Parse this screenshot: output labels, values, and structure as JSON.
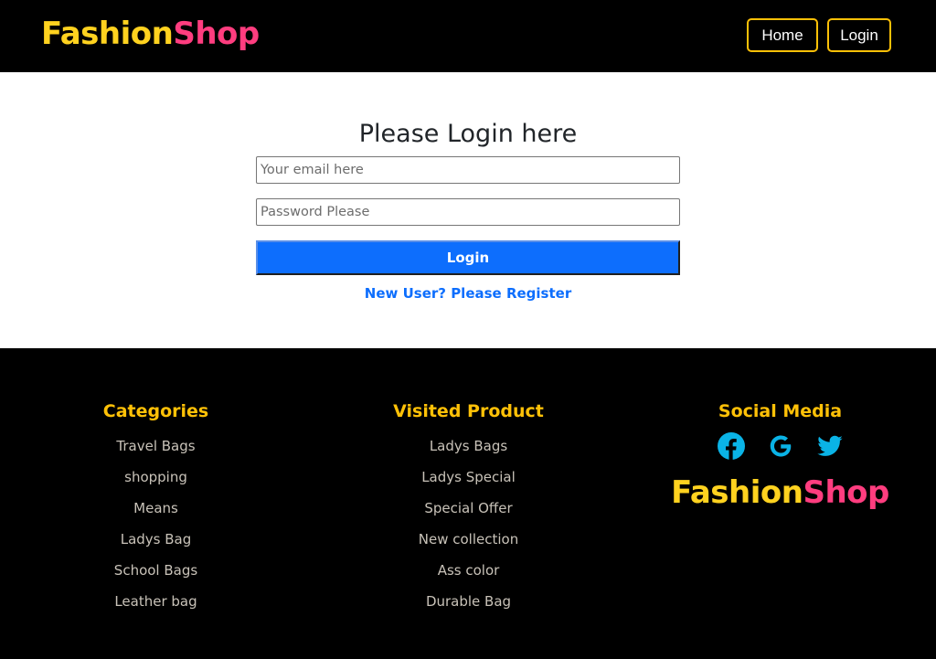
{
  "header": {
    "brand_part1": "Fashion",
    "brand_part2": "Shop",
    "nav": {
      "home_label": "Home",
      "login_label": "Login"
    }
  },
  "login_form": {
    "title": "Please Login here",
    "email_placeholder": "Your email here",
    "email_value": "",
    "password_placeholder": "Password Please",
    "password_value": "",
    "submit_label": "Login",
    "register_link": "New User? Please Register"
  },
  "footer": {
    "categories": {
      "heading": "Categories",
      "items": [
        "Travel Bags",
        "shopping",
        "Means",
        "Ladys Bag",
        "School Bags",
        "Leather bag"
      ]
    },
    "visited_product": {
      "heading": "Visited Product",
      "items": [
        "Ladys Bags",
        "Ladys Special",
        "Special Offer",
        "New collection",
        "Ass color",
        "Durable Bag"
      ]
    },
    "social_media": {
      "heading": "Social Media",
      "icons": [
        "facebook-icon",
        "google-icon",
        "twitter-icon"
      ],
      "brand_part1": "Fashion",
      "brand_part2": "Shop"
    }
  },
  "colors": {
    "brand_yellow": "#ffd21f",
    "brand_pink": "#ff3d7f",
    "accent_yellow": "#ffc107",
    "primary_blue": "#0d6efd",
    "social_icon_blue": "#0ab3e6",
    "footer_link": "#c8c2b8"
  }
}
